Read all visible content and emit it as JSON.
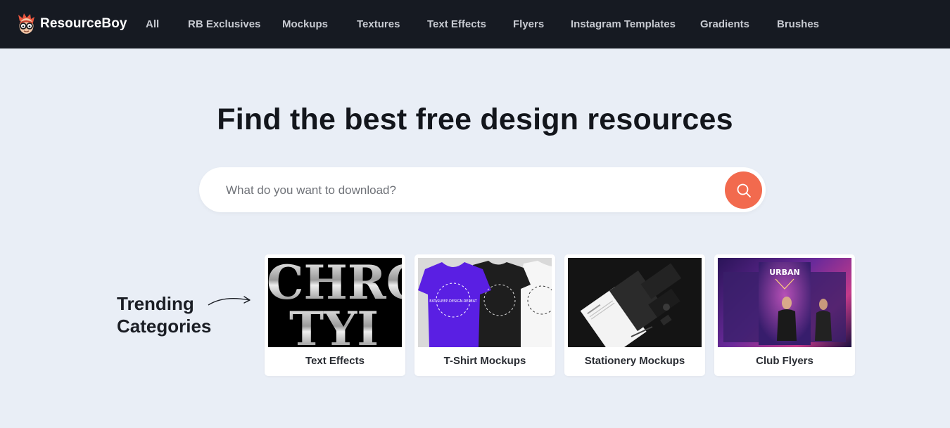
{
  "brand": {
    "name": "ResourceBoy"
  },
  "nav": [
    {
      "label": "All"
    },
    {
      "label": "RB Exclusives"
    },
    {
      "label": "Mockups"
    },
    {
      "label": "Textures"
    },
    {
      "label": "Text Effects"
    },
    {
      "label": "Flyers"
    },
    {
      "label": "Instagram Templates"
    },
    {
      "label": "Gradients"
    },
    {
      "label": "Brushes"
    }
  ],
  "hero": {
    "title": "Find the best free design resources",
    "search_placeholder": "What do you want to download?"
  },
  "trending": {
    "label_line1": "Trending",
    "label_line2": "Categories",
    "cards": [
      {
        "label": "Text Effects",
        "thumb_text_1": "CHRO",
        "thumb_text_2": "TYI"
      },
      {
        "label": "T-Shirt Mockups",
        "shirt_text": "EAT·SLEEP·DESIGN·REPEAT"
      },
      {
        "label": "Stationery Mockups"
      },
      {
        "label": "Club Flyers",
        "thumb_text": "URBAN"
      }
    ]
  },
  "colors": {
    "nav_bg": "#161a22",
    "page_bg": "#e9eef6",
    "accent": "#f26a4e"
  }
}
